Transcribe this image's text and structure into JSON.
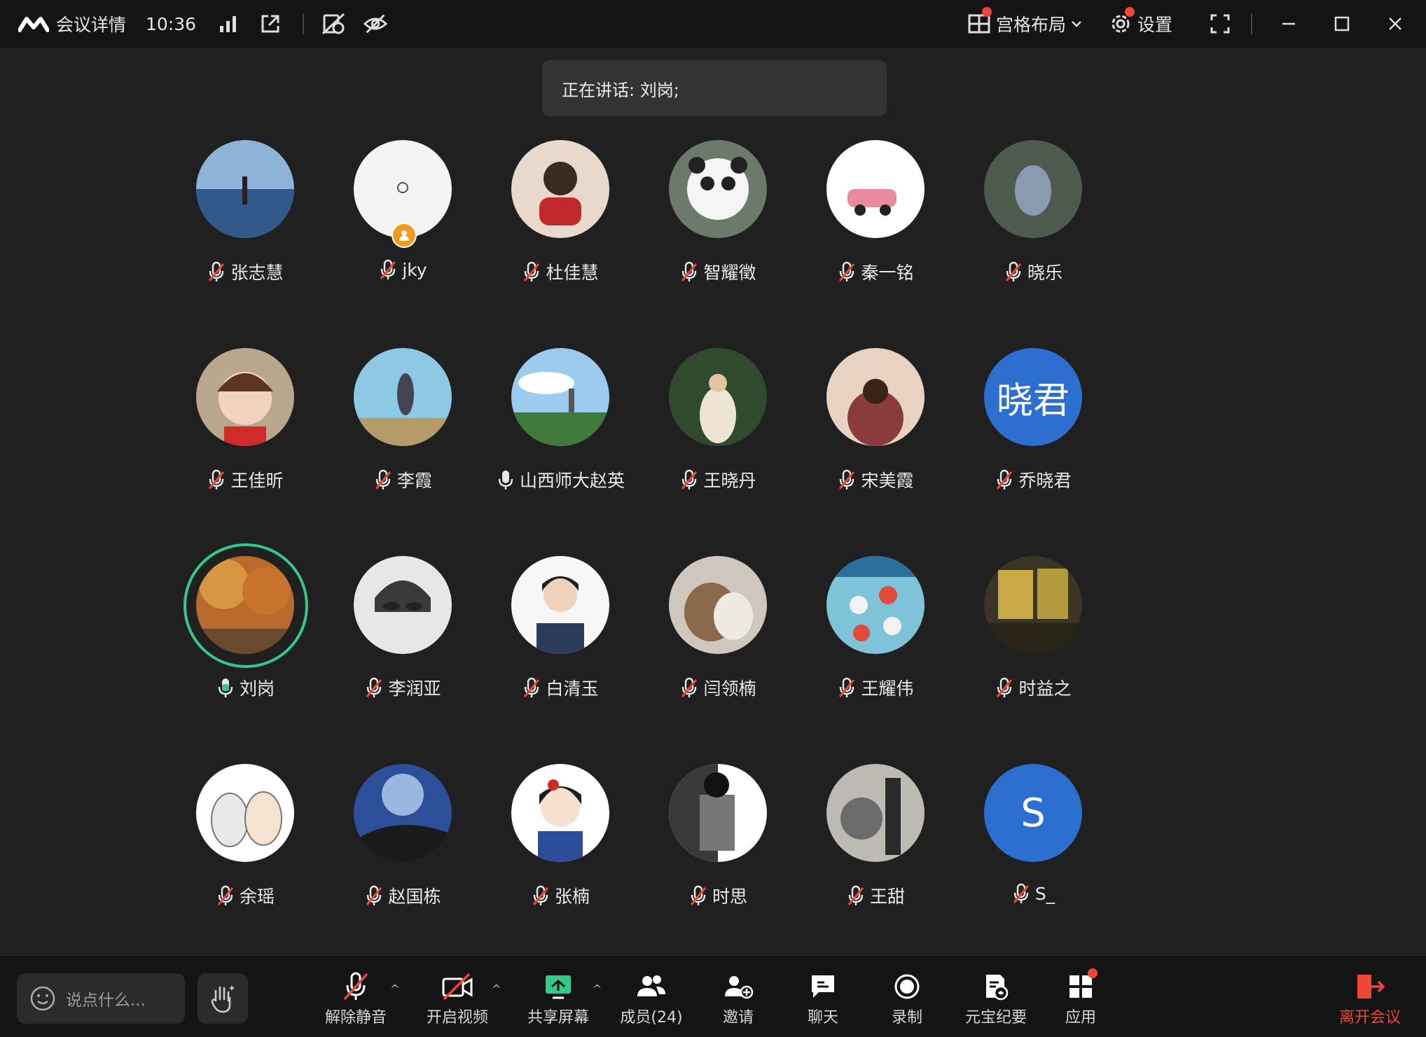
{
  "topbar": {
    "title": "会议详情",
    "time": "10:36",
    "layout_label": "宫格布局",
    "settings_label": "设置"
  },
  "speaking_banner": "正在讲话: 刘岗;",
  "participants": [
    {
      "name": "张志慧",
      "mic": "muted"
    },
    {
      "name": "jky",
      "mic": "muted",
      "host": true
    },
    {
      "name": "杜佳慧",
      "mic": "muted"
    },
    {
      "name": "智耀徵",
      "mic": "muted"
    },
    {
      "name": "秦一铭",
      "mic": "muted"
    },
    {
      "name": "晓乐",
      "mic": "muted"
    },
    {
      "name": "王佳昕",
      "mic": "muted"
    },
    {
      "name": "李霞",
      "mic": "muted"
    },
    {
      "name": "山西师大赵英",
      "mic": "on"
    },
    {
      "name": "王晓丹",
      "mic": "muted"
    },
    {
      "name": "宋美霞",
      "mic": "muted"
    },
    {
      "name": "乔晓君",
      "mic": "muted",
      "avatar_text": "晓君"
    },
    {
      "name": "刘岗",
      "mic": "speaking",
      "speaking": true
    },
    {
      "name": "李润亚",
      "mic": "muted"
    },
    {
      "name": "白清玉",
      "mic": "muted"
    },
    {
      "name": "闫领楠",
      "mic": "muted"
    },
    {
      "name": "王耀伟",
      "mic": "muted"
    },
    {
      "name": "时益之",
      "mic": "muted"
    },
    {
      "name": "余瑶",
      "mic": "muted"
    },
    {
      "name": "赵国栋",
      "mic": "muted"
    },
    {
      "name": "张楠",
      "mic": "muted"
    },
    {
      "name": "时思",
      "mic": "muted"
    },
    {
      "name": "王甜",
      "mic": "muted"
    },
    {
      "name": "S_",
      "mic": "muted",
      "avatar_text": "S"
    }
  ],
  "bottombar": {
    "chat_placeholder": "说点什么...",
    "unmute": "解除静音",
    "video": "开启视频",
    "share": "共享屏幕",
    "members": "成员(24)",
    "invite": "邀请",
    "chat": "聊天",
    "record": "录制",
    "yuanbao": "元宝纪要",
    "apps": "应用",
    "leave": "离开会议"
  },
  "colors": {
    "accent_green": "#34c98b",
    "leave_red": "#f0453a",
    "avatar_blue": "#2c6fd1"
  }
}
